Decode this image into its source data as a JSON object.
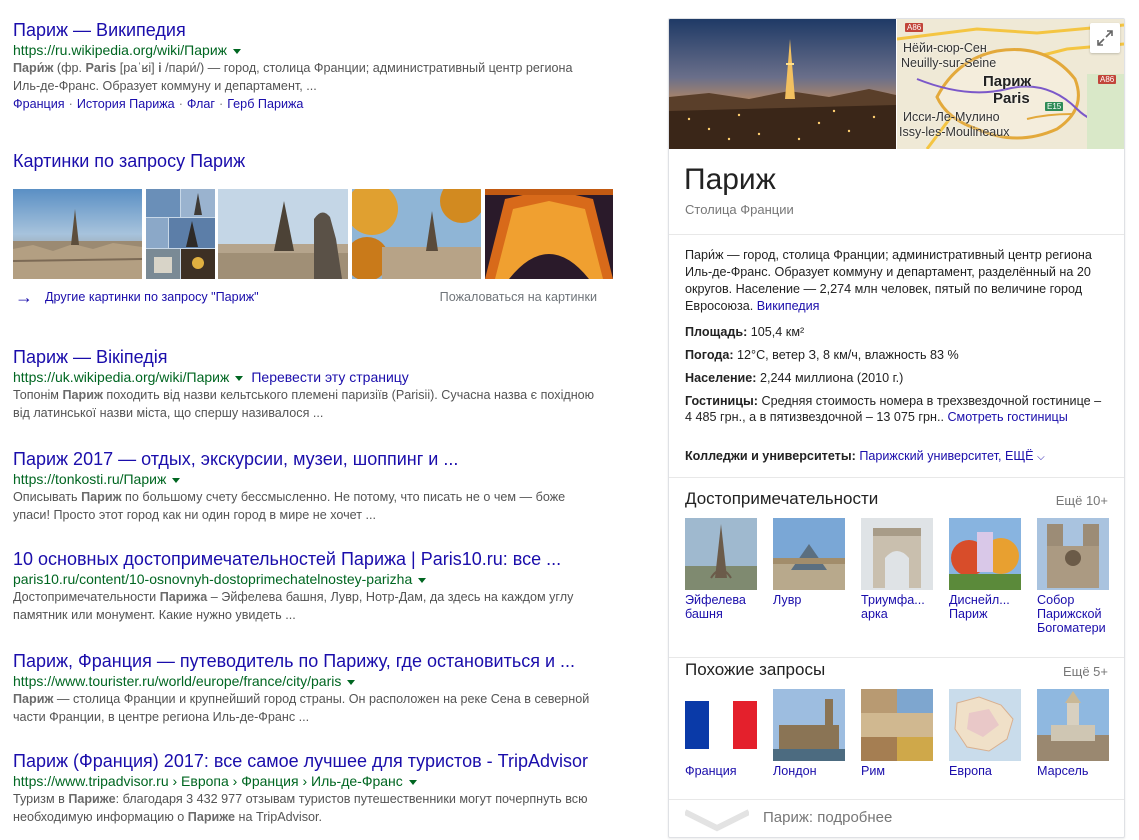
{
  "results": [
    {
      "title": "Париж — Википедия",
      "url": "https://ru.wikipedia.org/wiki/Париж",
      "snippet_parts": [
        [
          "b",
          "Пари́ж"
        ],
        [
          "t",
          " (фр. "
        ],
        [
          "b",
          "Paris"
        ],
        [
          "t",
          " [paˈʁi] "
        ],
        [
          "b",
          "i"
        ],
        [
          "t",
          " /пари́/) — город, столица Франции; административный центр региона Иль-де-Франс. Образует коммуну и департамент, ..."
        ]
      ],
      "sitelinks": [
        "Франция",
        "История Парижа",
        "Флаг",
        "Герб Парижа"
      ]
    }
  ],
  "images_block": {
    "heading": "Картинки по запросу Париж",
    "more_link": "Другие картинки по запросу \"Париж\"",
    "report_link": "Пожаловаться на картинки"
  },
  "results2": [
    {
      "title": "Париж — Вікіпедія",
      "url": "https://uk.wikipedia.org/wiki/Париж",
      "translate": "Перевести эту страницу",
      "line1_pre": "Топонім ",
      "line1_b": "Париж",
      "line1_post": " походить від назви кельтського племені паризіїв (Parisii). Сучасна назва є похідною",
      "line2": "від латинської назви міста, що спершу називалося ..."
    },
    {
      "title": "Париж 2017 — отдых, экскурсии, музеи, шоппинг и ...",
      "url": "https://tonkosti.ru/Париж",
      "line1_pre": "Описывать ",
      "line1_b": "Париж",
      "line1_post": " по большому счету бессмысленно. Не потому, что писать не о чем — боже",
      "line2": "упаси! Просто этот город как ни один город в мире не хочет ..."
    },
    {
      "title": "10 основных достопримечательностей Парижа | Paris10.ru: все ...",
      "url": "paris10.ru/content/10-osnovnyh-dostoprimechatelnostey-parizha",
      "line1_pre": "Достопримечательности ",
      "line1_b": "Парижа",
      "line1_post": " – Эйфелева башня, Лувр, Нотр-Дам, да здесь на каждом углу",
      "line2": "памятник или монумент. Какие нужно увидеть ..."
    },
    {
      "title": "Париж, Франция — путеводитель по Парижу, где остановиться и ...",
      "url": "https://www.tourister.ru/world/europe/france/city/paris",
      "line1_pre": "",
      "line1_b": "Париж",
      "line1_post": " — столица Франции и крупнейший город страны. Он расположен на реке Сена в северной",
      "line2": "части Франции, в центре региона Иль-де-Франс ..."
    },
    {
      "title": "Париж (Франция) 2017: все самое лучшее для туристов - TripAdvisor",
      "url": "https://www.tripadvisor.ru › Европа › Франция › Иль-де-Франс",
      "line1_pre": "Туризм в ",
      "line1_b": "Париже",
      "line1_post": ": благодаря 3 432 977 отзывам туристов путешественники могут почерпнуть всю",
      "line2_pre": "необходимую информацию о ",
      "line2_b": "Париже",
      "line2_post": " на TripAdvisor."
    }
  ],
  "knowledge_panel": {
    "map_labels": {
      "top": "Нёйи-сюр-Сен",
      "top2": "Neuilly-sur-Seine",
      "city_ru": "Париж",
      "city_en": "Paris",
      "bottom": "Исси-Ле-Мулино",
      "bottom2": "Issy-les-Moulineaux",
      "road1": "A86",
      "road2": "A86",
      "road3": "E15"
    },
    "title": "Париж",
    "subtitle": "Столица Франции",
    "description": "Пари́ж — город, столица Франции; административный центр региона Иль-де-Франс. Образует коммуну и департамент, разделённый на 20 округов. Население — 2,274 млн человек, пятый по величине город Евросоюза.",
    "description_link": "Википедия",
    "facts": {
      "area_label": "Площадь:",
      "area_value": "105,4 км²",
      "weather_label": "Погода:",
      "weather_value": "12°C, ветер З, 8 км/ч, влажность 83 %",
      "population_label": "Население:",
      "population_value": "2,244 миллиона (2010 г.)",
      "hotels_label": "Гостиницы:",
      "hotels_value": "Средняя стоимость номера в трехзвездочной гостинице – 4 485 грн., а в пятизвездочной – 13 075 грн..",
      "hotels_link": "Смотреть гостиницы",
      "colleges_label": "Колледжи и университеты:",
      "colleges_value": "Парижский университет, ЕЩЁ"
    },
    "attractions": {
      "heading": "Достопримечательности",
      "more": "Ещё 10+",
      "items": [
        "Эйфелева башня",
        "Лувр",
        "Триумфа... арка",
        "Диснейл... Париж",
        "Собор Парижской Богоматери"
      ]
    },
    "related": {
      "heading": "Похожие запросы",
      "more": "Ещё 5+",
      "items": [
        "Франция",
        "Лондон",
        "Рим",
        "Европа",
        "Марсель"
      ]
    },
    "footer": "Париж: подробнее"
  }
}
